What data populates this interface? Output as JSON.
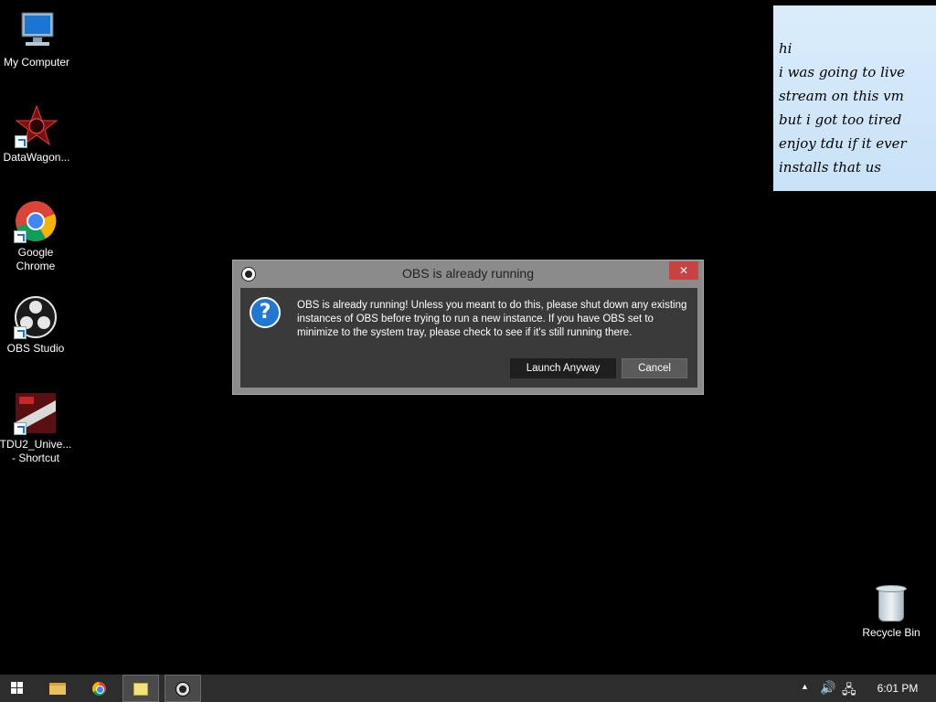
{
  "desktop": {
    "icons": [
      {
        "label": "My Computer"
      },
      {
        "label": "DataWagon..."
      },
      {
        "label_line1": "Google",
        "label_line2": "Chrome"
      },
      {
        "label": "OBS Studio"
      },
      {
        "label_line1": "TDU2_Unive...",
        "label_line2": "- Shortcut"
      }
    ],
    "recycle_bin": {
      "label": "Recycle Bin"
    }
  },
  "sticky_note": {
    "lines": [
      "hi",
      "i was going to live",
      "stream on this vm",
      "but i got too tired",
      "enjoy tdu if it ever",
      "installs that us"
    ],
    "color": "#d3e8fa"
  },
  "dialog": {
    "title": "OBS is already running",
    "close_label": "✕",
    "message": "OBS is already running! Unless you meant to do this, please shut down any existing instances of OBS before trying to run a new instance. If you have OBS set to minimize to the system tray, please check to see if it's still running there.",
    "icon": "question-icon",
    "buttons": {
      "launch_anyway": "Launch Anyway",
      "cancel": "Cancel"
    }
  },
  "taskbar": {
    "items": [
      "start-icon",
      "file-explorer-icon",
      "chrome-icon",
      "sticky-notes-icon",
      "obs-icon"
    ],
    "tray": {
      "chevron": "▲",
      "volume": "🔊",
      "network": "🖧"
    },
    "clock": "6:01 PM"
  }
}
